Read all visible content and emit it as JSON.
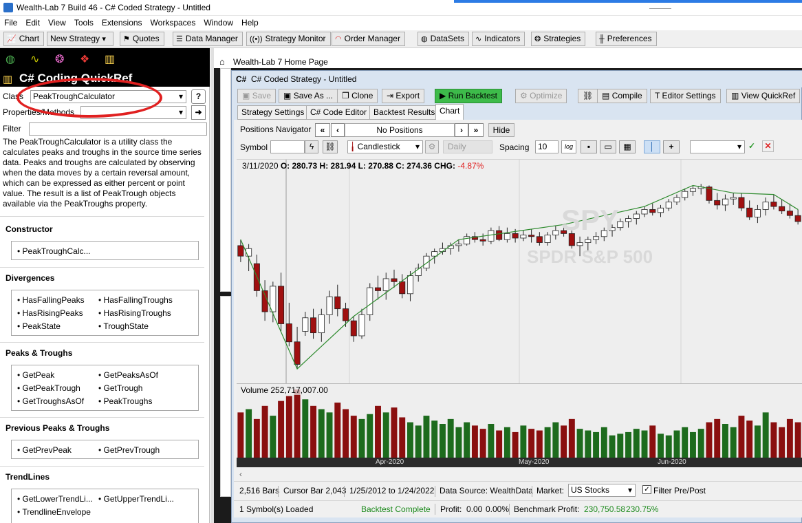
{
  "app": {
    "title": "Wealth-Lab 7 Build 46 - C# Coded Strategy - Untitled"
  },
  "menu": [
    "File",
    "Edit",
    "View",
    "Tools",
    "Extensions",
    "Workspaces",
    "Window",
    "Help"
  ],
  "toolbar": {
    "chart": "Chart",
    "new_strategy": "New Strategy",
    "quotes": "Quotes",
    "data_manager": "Data Manager",
    "strategy_monitor": "Strategy Monitor",
    "order_manager": "Order Manager",
    "datasets": "DataSets",
    "indicators": "Indicators",
    "strategies": "Strategies",
    "preferences": "Preferences"
  },
  "quickref": {
    "title": "C# Coding QuickRef",
    "class_label": "Class",
    "class_value": "PeakTroughCalculator",
    "props_label": "Properties/Methods",
    "filter_label": "Filter",
    "filter_value": "",
    "description": "The PeakTroughCalculator is a utility class the calculates peaks and troughs in the source time series data. Peaks and troughs are calculated by observing when the data moves by a certain reversal amount, which can be expressed as either percent or point value. The result is a list of PeakTrough objects available via the PeakTroughs property.",
    "sections": {
      "constructor": {
        "title": "Constructor",
        "items": [
          "PeakTroughCalc..."
        ]
      },
      "divergences": {
        "title": "Divergences",
        "items": [
          "HasFallingPeaks",
          "HasFallingTroughs",
          "HasRisingPeaks",
          "HasRisingTroughs",
          "PeakState",
          "TroughState"
        ]
      },
      "peaks": {
        "title": "Peaks & Troughs",
        "items": [
          "GetPeak",
          "GetPeaksAsOf",
          "GetPeakTrough",
          "GetTrough",
          "GetTroughsAsOf",
          "PeakTroughs"
        ]
      },
      "prev": {
        "title": "Previous Peaks & Troughs",
        "items": [
          "GetPrevPeak",
          "GetPrevTrough"
        ]
      },
      "trend": {
        "title": "TrendLines",
        "items": [
          "GetLowerTrendLi...",
          "GetUpperTrendLi...",
          "TrendlineEnvelope"
        ]
      }
    }
  },
  "home_tab": "Wealth-Lab 7 Home Page",
  "strategy": {
    "title": "C# Coded Strategy - Untitled",
    "buttons": {
      "save": "Save",
      "save_as": "Save As ...",
      "clone": "Clone",
      "export": "Export",
      "run": "Run Backtest",
      "optimize": "Optimize",
      "compile": "Compile",
      "editor_settings": "Editor Settings",
      "view_quickref": "View QuickRef"
    },
    "tabs": [
      "Strategy Settings",
      "C# Code Editor",
      "Backtest Results",
      "Chart"
    ]
  },
  "chart_panel": {
    "positions_nav": "Positions Navigator",
    "no_positions": "No Positions",
    "hide": "Hide",
    "symbol_label": "Symbol",
    "symbol_value": "",
    "chart_style": "Candlestick",
    "scale": "Daily",
    "spacing_label": "Spacing",
    "spacing_value": "10",
    "log": "log",
    "watermark_symbol": "SPY",
    "watermark_name": "SPDR S&P 500",
    "info_date": "3/11/2020",
    "info_ohlc": "O: 280.73  H: 281.94  L: 270.88  C: 274.36  CHG:",
    "info_chg": "-4.87%",
    "volume_label": "Volume 252,717,007.00",
    "dates": [
      "Apr-2020",
      "May-2020",
      "Jun-2020"
    ]
  },
  "status": {
    "bars": "2,516 Bars",
    "cursor": "Cursor Bar 2,043",
    "range": "1/25/2012 to 1/24/2022",
    "source": "Data Source: WealthData",
    "market_label": "Market:",
    "market_value": "US Stocks",
    "filter": "Filter Pre/Post",
    "loaded": "1 Symbol(s) Loaded",
    "backtest": "Backtest Complete",
    "profit_label": "Profit:",
    "profit": "0.00",
    "profit_pct": "0.00%",
    "bench_label": "Benchmark Profit:",
    "bench": "230,750.58",
    "bench_pct": "230.75%"
  },
  "colors": {
    "up": "#ffffff",
    "down": "#a01010",
    "vol_up": "#1d6b1d",
    "vol_down": "#8a0f0f",
    "peak_line": "#2e8b2e",
    "highlight": "#e02020",
    "status_green": "#1d8a1d"
  },
  "chart_data": {
    "type": "candlestick",
    "candles": [
      [
        282,
        286,
        271,
        275
      ],
      [
        275,
        283,
        265,
        280
      ],
      [
        270,
        276,
        248,
        252
      ],
      [
        252,
        259,
        232,
        238
      ],
      [
        238,
        258,
        231,
        255
      ],
      [
        255,
        264,
        225,
        230
      ],
      [
        230,
        244,
        215,
        218
      ],
      [
        218,
        228,
        200,
        203
      ],
      [
        225,
        238,
        222,
        234
      ],
      [
        234,
        240,
        220,
        224
      ],
      [
        224,
        240,
        218,
        236
      ],
      [
        236,
        252,
        230,
        248
      ],
      [
        248,
        256,
        235,
        240
      ],
      [
        240,
        244,
        228,
        232
      ],
      [
        232,
        235,
        218,
        222
      ],
      [
        222,
        240,
        220,
        236
      ],
      [
        236,
        257,
        232,
        254
      ],
      [
        254,
        262,
        246,
        252
      ],
      [
        252,
        264,
        246,
        260
      ],
      [
        260,
        266,
        254,
        258
      ],
      [
        258,
        263,
        247,
        250
      ],
      [
        250,
        265,
        245,
        262
      ],
      [
        262,
        270,
        258,
        267
      ],
      [
        267,
        277,
        265,
        275
      ],
      [
        275,
        280,
        270,
        278
      ],
      [
        278,
        284,
        276,
        280
      ],
      [
        280,
        284,
        276,
        282
      ],
      [
        282,
        286,
        278,
        283
      ],
      [
        283,
        290,
        282,
        288
      ],
      [
        288,
        291,
        284,
        286
      ],
      [
        286,
        290,
        282,
        285
      ],
      [
        285,
        294,
        283,
        292
      ],
      [
        292,
        295,
        285,
        286
      ],
      [
        286,
        294,
        284,
        290
      ],
      [
        290,
        293,
        284,
        287
      ],
      [
        287,
        292,
        285,
        289
      ],
      [
        289,
        293,
        284,
        288
      ],
      [
        288,
        291,
        282,
        284
      ],
      [
        284,
        291,
        282,
        289
      ],
      [
        289,
        295,
        286,
        292
      ],
      [
        292,
        296,
        288,
        290
      ],
      [
        290,
        292,
        280,
        282
      ],
      [
        282,
        288,
        275,
        284
      ],
      [
        284,
        288,
        278,
        286
      ],
      [
        286,
        291,
        283,
        288
      ],
      [
        288,
        294,
        285,
        292
      ],
      [
        292,
        296,
        288,
        294
      ],
      [
        294,
        300,
        292,
        298
      ],
      [
        298,
        302,
        294,
        300
      ],
      [
        300,
        305,
        296,
        303
      ],
      [
        303,
        308,
        301,
        306
      ],
      [
        306,
        310,
        302,
        304
      ],
      [
        304,
        309,
        301,
        307
      ],
      [
        307,
        313,
        305,
        311
      ],
      [
        311,
        316,
        309,
        314
      ],
      [
        314,
        320,
        312,
        318
      ],
      [
        318,
        322,
        315,
        320
      ],
      [
        320,
        323,
        316,
        321
      ],
      [
        321,
        322,
        310,
        312
      ],
      [
        312,
        317,
        306,
        309
      ],
      [
        309,
        316,
        305,
        313
      ],
      [
        313,
        317,
        309,
        314
      ],
      [
        314,
        317,
        305,
        307
      ],
      [
        307,
        312,
        299,
        301
      ],
      [
        301,
        309,
        297,
        306
      ],
      [
        306,
        314,
        302,
        311
      ],
      [
        311,
        316,
        306,
        308
      ],
      [
        308,
        313,
        303,
        305
      ],
      [
        305,
        310,
        300,
        302
      ],
      [
        302,
        306,
        296,
        298
      ]
    ],
    "volume": [
      140,
      150,
      120,
      160,
      130,
      175,
      190,
      210,
      180,
      160,
      150,
      140,
      170,
      150,
      130,
      120,
      135,
      160,
      140,
      155,
      125,
      110,
      100,
      130,
      115,
      105,
      120,
      95,
      110,
      100,
      90,
      105,
      85,
      95,
      80,
      100,
      90,
      85,
      95,
      110,
      100,
      120,
      90,
      85,
      80,
      95,
      70,
      75,
      80,
      90,
      85,
      100,
      75,
      70,
      85,
      95,
      80,
      90,
      110,
      120,
      105,
      95,
      130,
      115,
      100,
      140,
      110,
      95,
      120,
      110
    ]
  }
}
